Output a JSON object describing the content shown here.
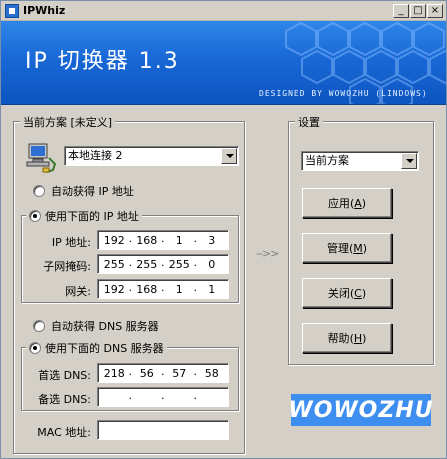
{
  "window": {
    "title": "IPWhiz",
    "minimize": "_",
    "maximize": "□",
    "close": "×"
  },
  "banner": {
    "title": "IP 切换器 1.3",
    "credit": "DESIGNED BY WOWOZHU (LINDOWS)"
  },
  "current_scheme": {
    "group_title": "当前方案 [未定义]",
    "adapter": "本地连接 2",
    "auto_ip_label": "自动获得 IP 地址",
    "manual_ip_label": "使用下面的 IP 地址",
    "ip_mode": "manual",
    "ip_label": "IP 地址:",
    "ip": [
      "192",
      "168",
      "1",
      "3"
    ],
    "mask_label": "子网掩码:",
    "mask": [
      "255",
      "255",
      "255",
      "0"
    ],
    "gateway_label": "网关:",
    "gateway": [
      "192",
      "168",
      "1",
      "1"
    ],
    "auto_dns_label": "自动获得 DNS 服务器",
    "manual_dns_label": "使用下面的 DNS 服务器",
    "dns_mode": "manual",
    "primary_dns_label": "首选 DNS:",
    "primary_dns": [
      "218",
      "56",
      "57",
      "58"
    ],
    "secondary_dns_label": "备选 DNS:",
    "secondary_dns": [
      "",
      "",
      "",
      ""
    ],
    "mac_label": "MAC 地址:",
    "mac": ""
  },
  "arrow": "-->>",
  "settings": {
    "group_title": "设置",
    "scheme_select": "当前方案",
    "apply_text": "应用",
    "apply_key": "A",
    "manage_text": "管理",
    "manage_key": "M",
    "close_text": "关闭",
    "close_key": "C",
    "help_text": "帮助",
    "help_key": "H"
  },
  "logo_text": "WOWOZHU",
  "icons": {
    "app": "app-icon",
    "adapter": "network-computer-icon"
  },
  "colors": {
    "banner": "#1868d6",
    "logo": "#3e8ef0",
    "face": "#d4d0c8"
  }
}
